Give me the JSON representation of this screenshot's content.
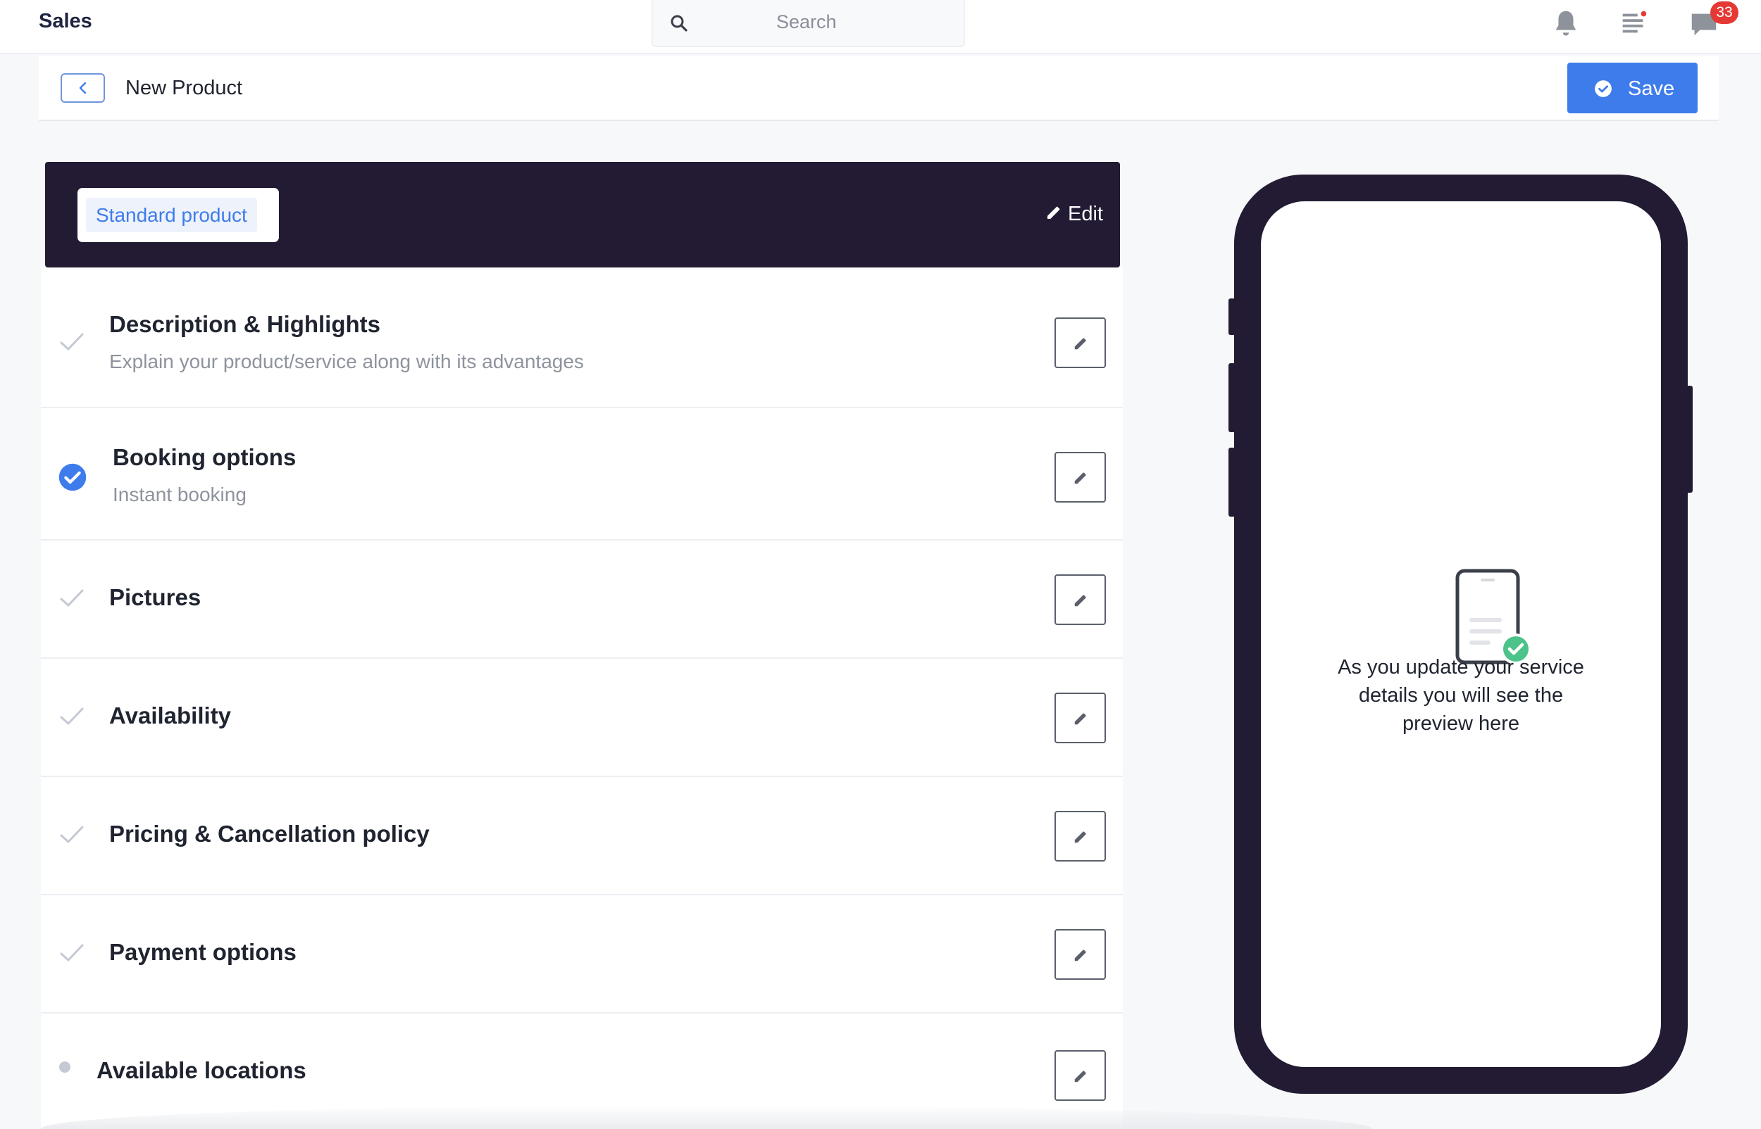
{
  "app": {
    "title": "Sales"
  },
  "search": {
    "placeholder": "Search"
  },
  "notifications": {
    "messages_count": "33"
  },
  "header": {
    "title": "New Product",
    "save_label": "Save"
  },
  "product": {
    "type_label": "Standard product",
    "edit_label": "Edit"
  },
  "sections": [
    {
      "title": "Description & Highlights",
      "subtitle": "Explain your product/service along with its advantages",
      "status": "done"
    },
    {
      "title": "Booking options",
      "subtitle": "Instant booking",
      "status": "completed"
    },
    {
      "title": "Pictures",
      "subtitle": "",
      "status": "done"
    },
    {
      "title": "Availability",
      "subtitle": "",
      "status": "done"
    },
    {
      "title": "Pricing & Cancellation policy",
      "subtitle": "",
      "status": "done"
    },
    {
      "title": "Payment options",
      "subtitle": "",
      "status": "done"
    },
    {
      "title": "Available locations",
      "subtitle": "",
      "status": "pending"
    }
  ],
  "preview": {
    "message": "As you update your service details you will see the preview here"
  },
  "colors": {
    "accent": "#3f7ceb",
    "dark": "#221b33",
    "success": "#4cc38a",
    "badge": "#e53935"
  }
}
